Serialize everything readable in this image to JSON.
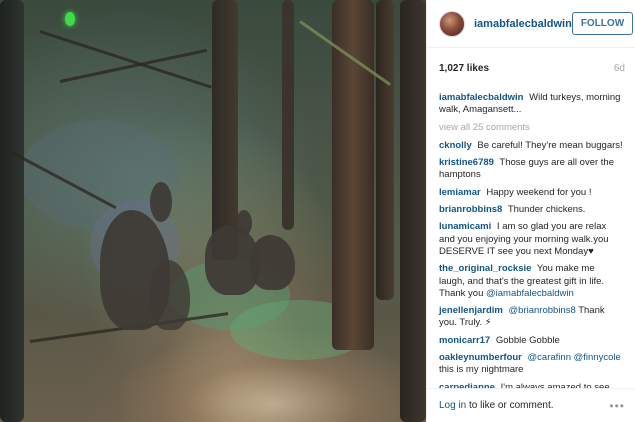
{
  "post": {
    "username": "iamabfalecbaldwin",
    "follow_label": "FOLLOW",
    "likes": "1,027 likes",
    "age": "6d",
    "caption": {
      "user": "iamabfalecbaldwin",
      "text": "Wild turkeys, morning walk, Amagansett..."
    },
    "view_all": "view all 25 comments",
    "comments": [
      {
        "user": "cknolly",
        "text": "Be careful! They're mean buggars!"
      },
      {
        "user": "kristine6789",
        "text": "Those guys are all over the hamptons"
      },
      {
        "user": "lemiamar",
        "text": "Happy weekend for you !"
      },
      {
        "user": "brianrobbins8",
        "text": "Thunder chickens."
      },
      {
        "user": "lunamicami",
        "text": "I am so glad you are relax and you enjoying your morning walk.you DESERVE IT see you next Monday♥"
      },
      {
        "user": "the_original_rocksie",
        "text": "You make me laugh, and that's the greatest gift in life. Thank you",
        "mention": "@iamabfalecbaldwin"
      },
      {
        "user": "jenellenjardim",
        "text": "Thank you. Truly. ⚡︎",
        "mention_before": "@brianrobbins8"
      },
      {
        "user": "monicarr17",
        "text": "Gobble Gobble"
      },
      {
        "user": "oakleynumberfour",
        "mention_before": "@carafinn @finnycole",
        "text": "this is my nightmare"
      },
      {
        "user": "carpedianne",
        "text": "I'm always amazed to see"
      }
    ],
    "footer": {
      "login_link": "Log in",
      "login_rest": "to like or comment.",
      "more_icon": "ellipsis-icon"
    },
    "photo_alt_icon": "green-light-icon",
    "colors": {
      "username": "#125688",
      "follow": "#3f729b",
      "muted": "#a5a7aa"
    }
  }
}
